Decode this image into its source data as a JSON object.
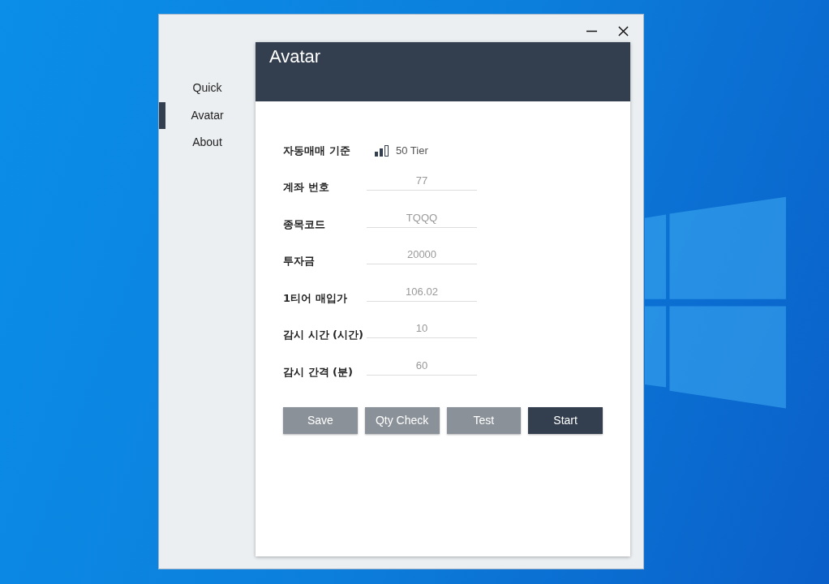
{
  "sidebar": {
    "items": [
      {
        "label": "Quick",
        "selected": false
      },
      {
        "label": "Avatar",
        "selected": true
      },
      {
        "label": "About",
        "selected": false
      }
    ]
  },
  "page": {
    "title": "Avatar"
  },
  "tier_row": {
    "label": "자동매매 기준",
    "value": "50 Tier"
  },
  "fields": [
    {
      "label": "계좌 번호",
      "value": "77"
    },
    {
      "label": "종목코드",
      "value": "TQQQ"
    },
    {
      "label": "투자금",
      "value": "20000"
    },
    {
      "label": "1티어 매입가",
      "value": "106.02"
    },
    {
      "label": "감시 시간 (시간)",
      "value": "10"
    },
    {
      "label": "감시 간격 (분)",
      "value": "60"
    }
  ],
  "buttons": [
    {
      "label": "Save",
      "kind": "secondary"
    },
    {
      "label": "Qty Check",
      "kind": "secondary"
    },
    {
      "label": "Test",
      "kind": "secondary"
    },
    {
      "label": "Start",
      "kind": "primary"
    }
  ]
}
